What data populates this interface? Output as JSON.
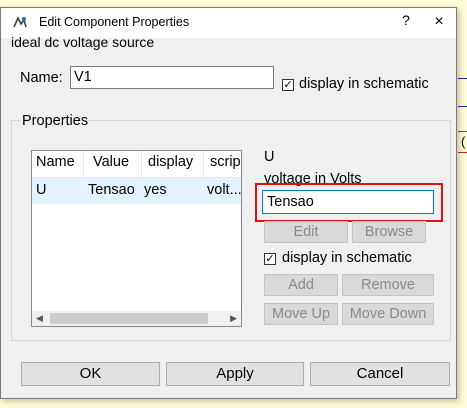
{
  "background": {
    "fragments": [
      "o",
      "V",
      "(",
      "C"
    ]
  },
  "dialog": {
    "title": "Edit Component Properties",
    "help": "?",
    "close": "×",
    "component_type": "ideal dc voltage source",
    "name_label": "Name:",
    "name_value": "V1",
    "name_display_checked": true,
    "name_display_label": "display in schematic",
    "properties_label": "Properties",
    "table": {
      "columns": [
        "Name",
        "Value",
        "display",
        "scrip"
      ],
      "rows": [
        {
          "name": "U",
          "value": "Tensao",
          "display": "yes",
          "script": "volt..."
        }
      ]
    },
    "param_name": "U",
    "param_description": "voltage in Volts",
    "param_value": "Tensao",
    "edit_button": "Edit",
    "browse_button": "Browse",
    "param_display_checked": true,
    "param_display_label": "display in schematic",
    "add_button": "Add",
    "remove_button": "Remove",
    "move_up_button": "Move Up",
    "move_down_button": "Move Down",
    "ok_button": "OK",
    "apply_button": "Apply",
    "cancel_button": "Cancel"
  },
  "colors": {
    "highlight_box": "#e01010",
    "focus_border": "#0078d7",
    "schematic_background": "#fffcd8"
  }
}
